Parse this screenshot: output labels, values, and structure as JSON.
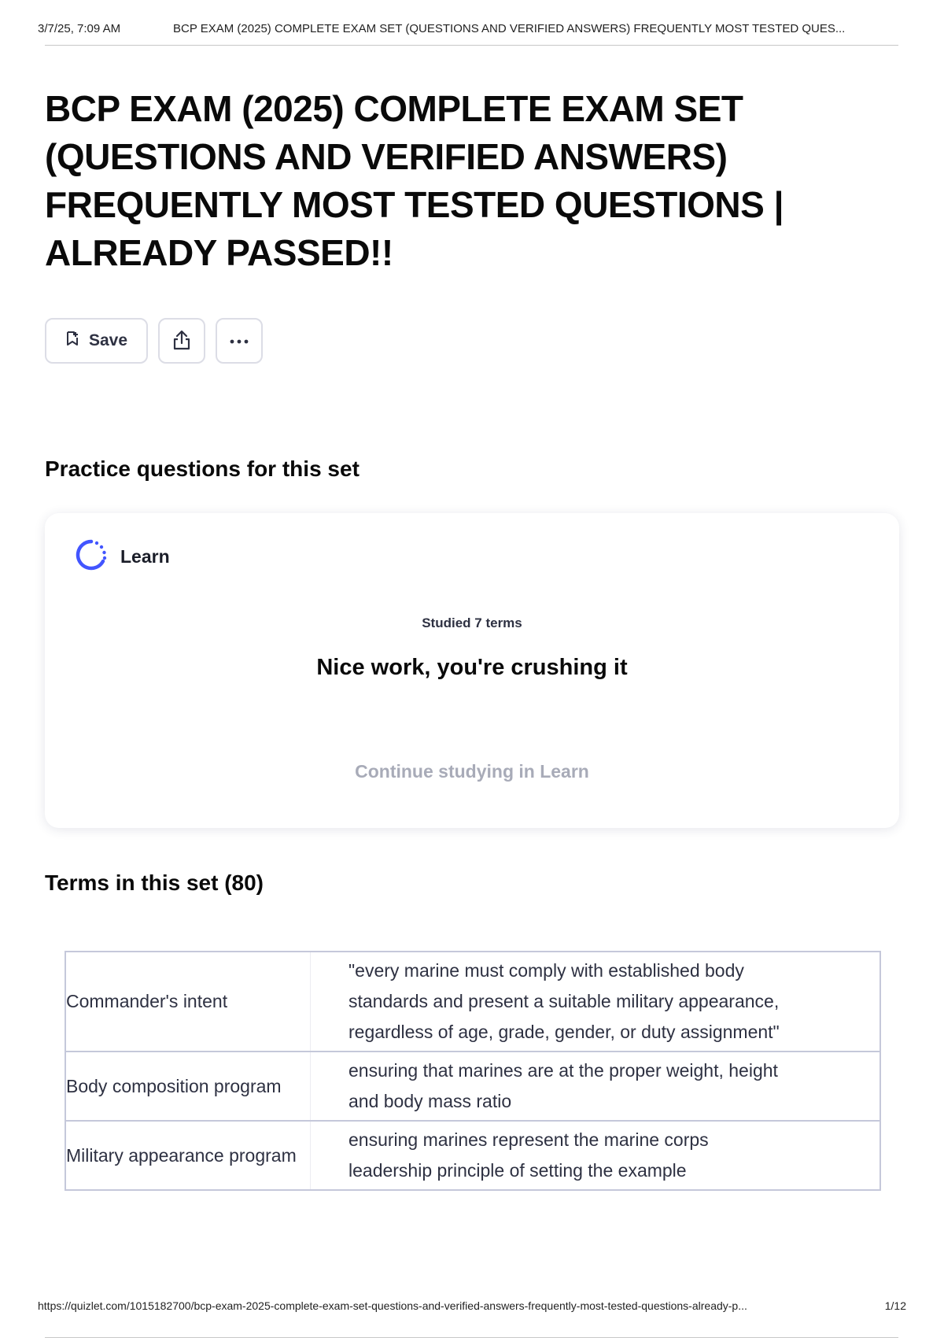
{
  "print_header": {
    "datetime": "3/7/25, 7:09 AM",
    "title": "BCP EXAM (2025) COMPLETE EXAM SET (QUESTIONS AND VERIFIED ANSWERS) FREQUENTLY MOST TESTED QUES..."
  },
  "set": {
    "title": "BCP EXAM (2025) COMPLETE EXAM SET (QUESTIONS AND VERIFIED ANSWERS) FREQUENTLY MOST TESTED QUESTIONS | ALREADY PASSED!!"
  },
  "actions": {
    "save_label": "Save",
    "save_icon": "bookmark-icon",
    "share_icon": "share-icon",
    "more_icon": "more-options-icon"
  },
  "practice": {
    "heading": "Practice questions for this set",
    "mode_label": "Learn",
    "mode_icon": "learn-progress-icon",
    "studied_text": "Studied 7 terms",
    "praise_text": "Nice work, you're crushing it",
    "continue_label": "Continue studying in Learn",
    "accent_color": "#4255ff"
  },
  "terms": {
    "heading": "Terms in this set (80)",
    "rows": [
      {
        "term": "Commander's intent",
        "definition": "\"every marine must comply with established body standards and present a suitable military appearance, regardless of age, grade, gender, or duty assignment\""
      },
      {
        "term": "Body composition program",
        "definition": "ensuring that marines are at the proper weight, height and body mass ratio"
      },
      {
        "term": "Military appearance program",
        "definition": "ensuring marines represent the marine corps leadership principle of setting the example"
      }
    ]
  },
  "print_footer": {
    "url": "https://quizlet.com/1015182700/bcp-exam-2025-complete-exam-set-questions-and-verified-answers-frequently-most-tested-questions-already-p...",
    "page": "1/12"
  }
}
